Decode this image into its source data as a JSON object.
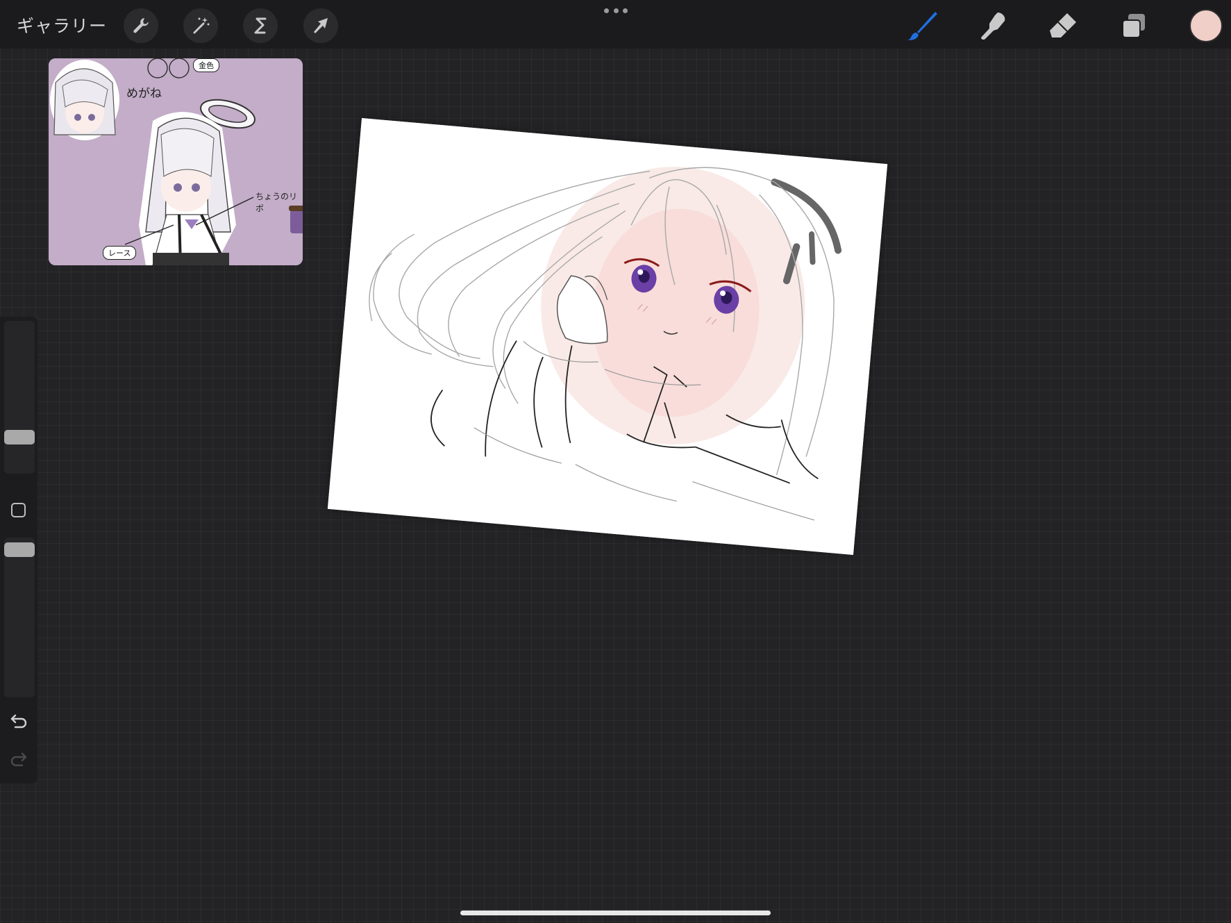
{
  "app": {
    "name": "Procreate"
  },
  "toolbar": {
    "gallery_label": "ギャラリー",
    "left_tools": [
      {
        "name": "actions",
        "icon": "wrench-icon"
      },
      {
        "name": "adjustments",
        "icon": "magic-wand-icon"
      },
      {
        "name": "selection",
        "icon": "selection-s-icon"
      },
      {
        "name": "transform",
        "icon": "arrow-cursor-icon"
      }
    ],
    "more_icon": "more-dots-icon",
    "right_tools": [
      {
        "name": "brush",
        "icon": "brush-icon",
        "active": true
      },
      {
        "name": "smudge",
        "icon": "smudge-finger-icon",
        "active": false
      },
      {
        "name": "eraser",
        "icon": "eraser-icon",
        "active": false
      },
      {
        "name": "layers",
        "icon": "layers-icon",
        "active": false
      }
    ],
    "current_color": "#f0cfc8",
    "active_tool_color": "#1f6fe0"
  },
  "reference": {
    "background_color": "#c3adc8",
    "labels": {
      "glasses": "めがね",
      "gold": "金色",
      "ribbon": "ちょうのリボ",
      "lace": "レース"
    }
  },
  "sidebar": {
    "brush_size_level": 0.25,
    "opacity_level": 0.95,
    "undo_icon": "undo-icon",
    "redo_icon": "redo-icon"
  },
  "canvas": {
    "background": "#ffffff",
    "skin_tone": "#f7dcd8",
    "eye_color": "#6a3fa6"
  }
}
